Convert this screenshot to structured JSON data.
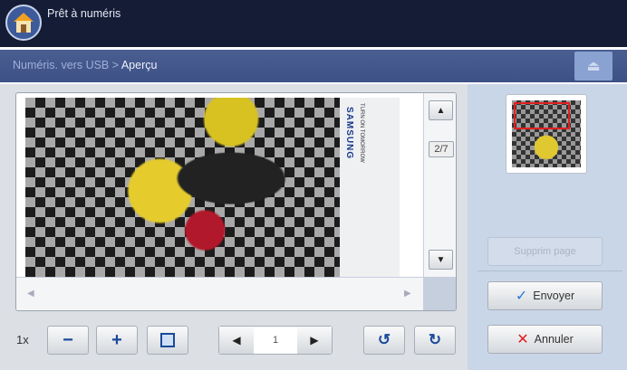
{
  "header": {
    "status": "Prêt à numéris"
  },
  "breadcrumb": {
    "parent": "Numéris. vers USB",
    "separator": " > ",
    "current": "Aperçu"
  },
  "preview": {
    "page_indicator": "2/7",
    "brand_text": "SAMSUNG",
    "slogan_text": "TURN ON TOMORROW"
  },
  "toolbar": {
    "zoom_level": "1x",
    "zoom_out": "−",
    "zoom_in": "+",
    "page_value": "1",
    "prev": "◀",
    "next": "▶"
  },
  "actions": {
    "delete_page": "Supprim page",
    "send": "Envoyer",
    "cancel": "Annuler"
  },
  "colors": {
    "accent": "#1a4a9a",
    "cancel": "#e02020",
    "send": "#2a7ad8"
  }
}
